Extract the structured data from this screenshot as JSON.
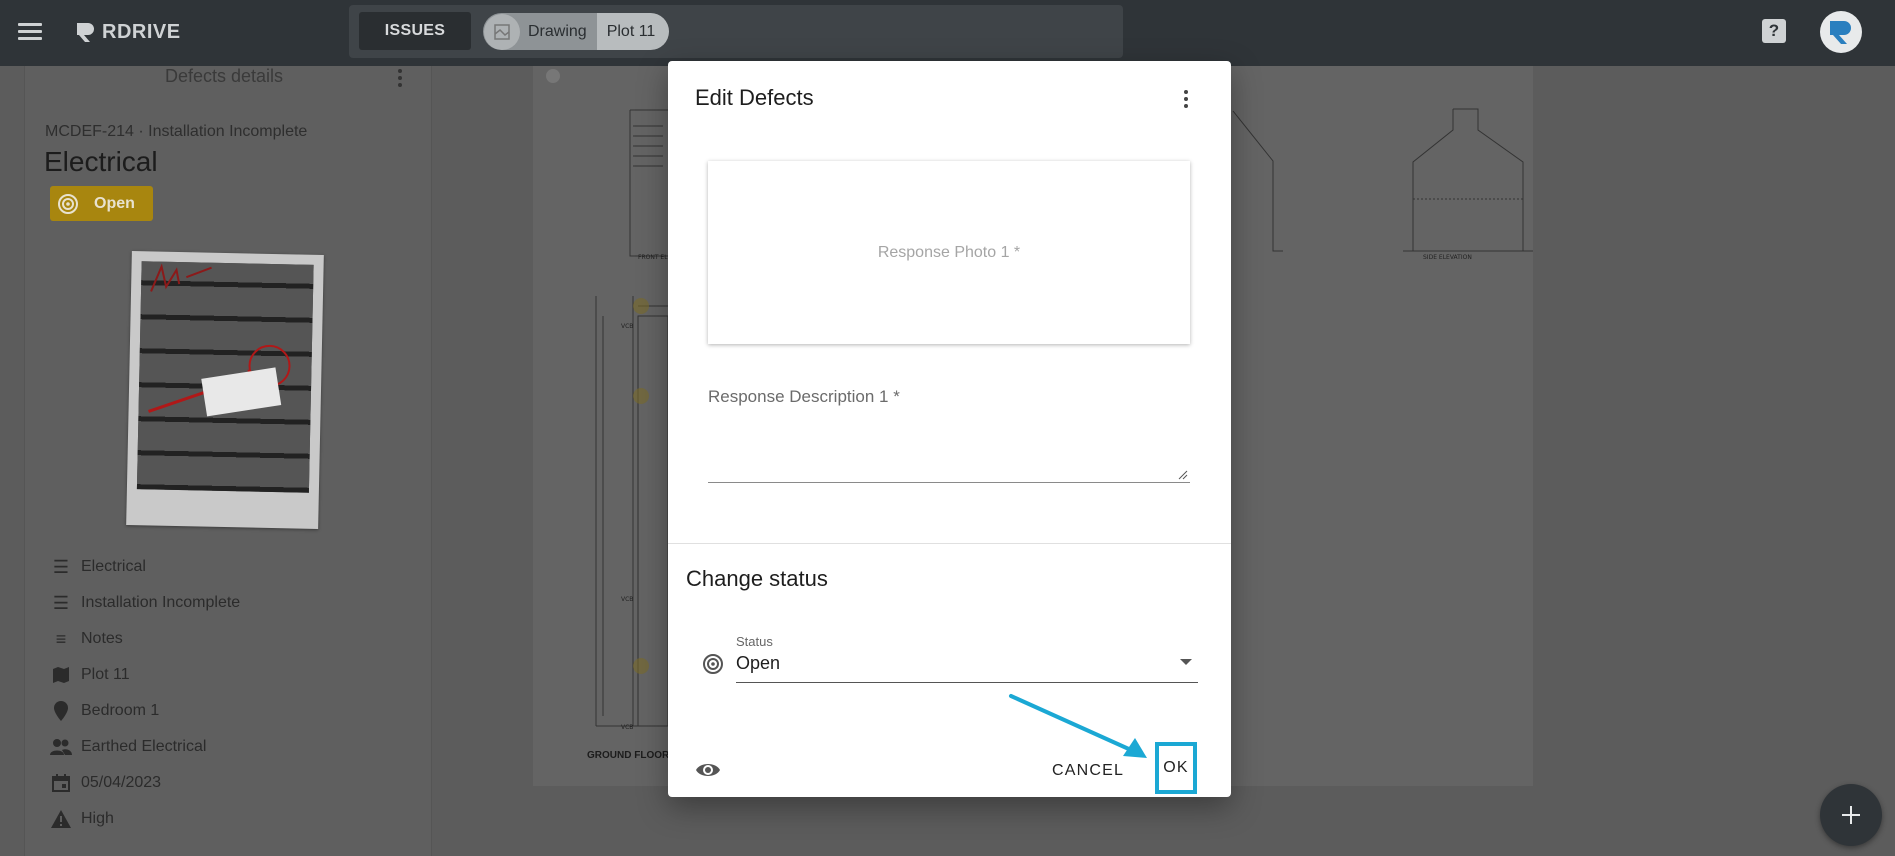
{
  "app": {
    "logo_text": "RDRIVE"
  },
  "topbar": {
    "issues_label": "ISSUES",
    "chip_drawing": "Drawing",
    "chip_plot": "Plot 11",
    "help_icon": "help-icon",
    "user_icon": "user-avatar"
  },
  "panel": {
    "title": "Defects details",
    "code": "MCDEF-214 · Installation Incomplete",
    "name": "Electrical",
    "status": "Open",
    "status_color": "#d7a81c",
    "props": [
      {
        "icon": "list-icon",
        "label": "Electrical"
      },
      {
        "icon": "list-icon",
        "label": "Installation Incomplete"
      },
      {
        "icon": "notes-icon",
        "label": "Notes"
      },
      {
        "icon": "map-icon",
        "label": "Plot 11"
      },
      {
        "icon": "location-pin-icon",
        "label": "Bedroom 1"
      },
      {
        "icon": "people-icon",
        "label": "Earthed Electrical"
      },
      {
        "icon": "calendar-icon",
        "label": "05/04/2023"
      },
      {
        "icon": "warning-icon",
        "label": "High"
      }
    ]
  },
  "drawing": {
    "floor_label": "GROUND FLOOR P"
  },
  "dialog": {
    "title": "Edit Defects",
    "photo_placeholder": "Response Photo 1 *",
    "desc_label": "Response Description 1 *",
    "desc_value": "",
    "change_status_title": "Change status",
    "status_label": "Status",
    "status_value": "Open",
    "cancel_label": "CANCEL",
    "ok_label": "OK",
    "accent_color": "#1ba8d4"
  }
}
